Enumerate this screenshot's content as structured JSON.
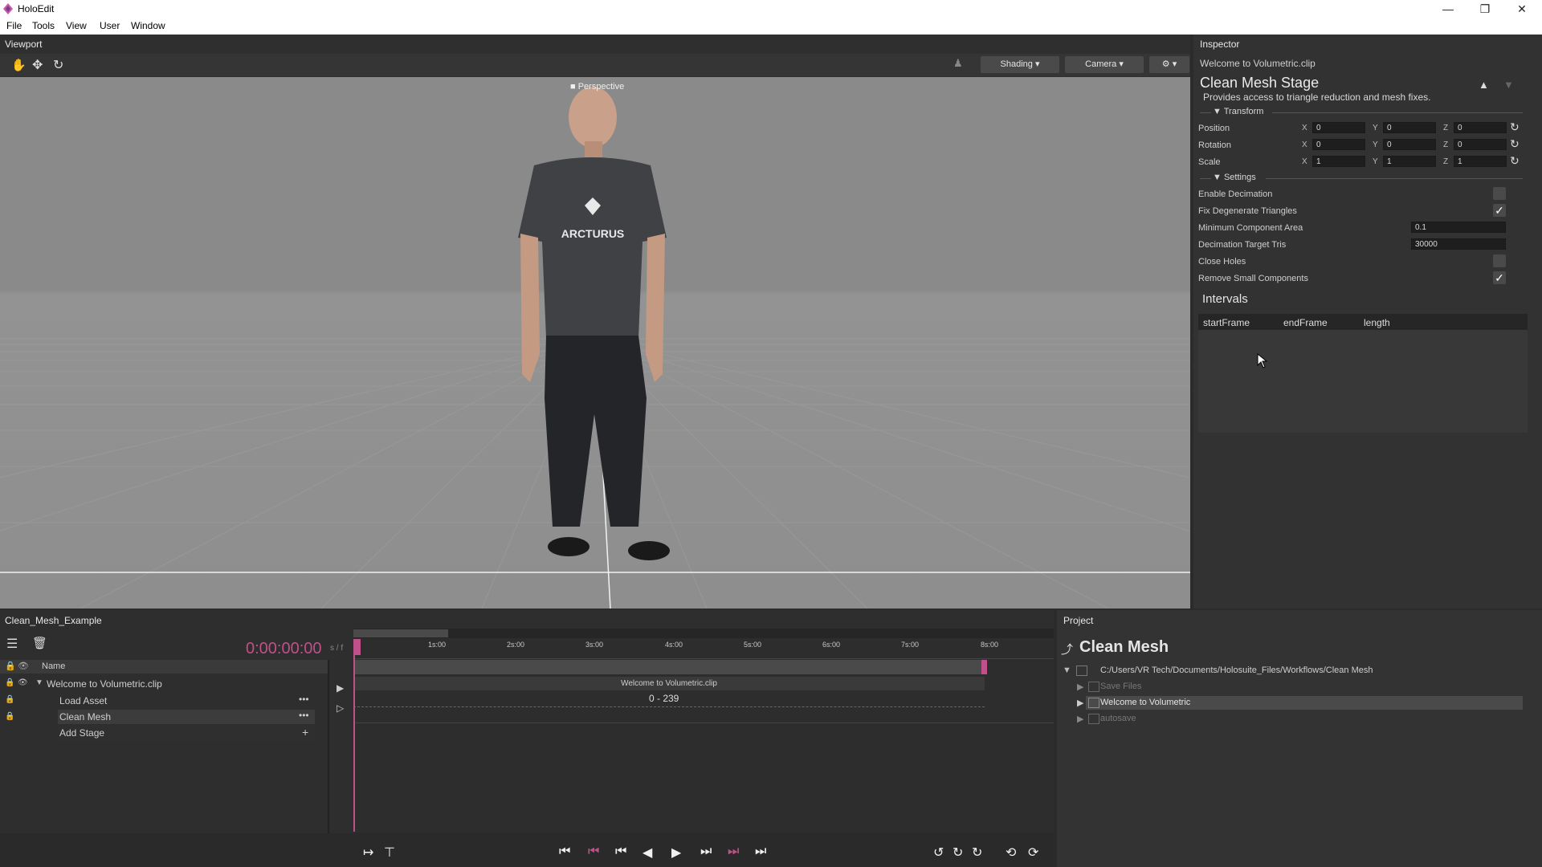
{
  "app": {
    "title": "HoloEdit",
    "window_controls": [
      "—",
      "❐",
      "✕"
    ]
  },
  "menu": [
    "File",
    "Tools",
    "View",
    "User",
    "Window"
  ],
  "viewport": {
    "tab": "Viewport",
    "shading_label": "Shading",
    "camera_label": "Camera",
    "perspective_label": "Perspective",
    "shirt_text": "ARCTURUS"
  },
  "inspector": {
    "tab": "Inspector",
    "clip_name": "Welcome to Volumetric.clip",
    "stage_title": "Clean Mesh Stage",
    "stage_desc": "Provides access to triangle reduction and mesh fixes.",
    "transform_label": "Transform",
    "position_label": "Position",
    "rotation_label": "Rotation",
    "scale_label": "Scale",
    "axis_x": "X",
    "axis_y": "Y",
    "axis_z": "Z",
    "position": [
      "0",
      "0",
      "0"
    ],
    "rotation": [
      "0",
      "0",
      "0"
    ],
    "scale": [
      "1",
      "1",
      "1"
    ],
    "settings_label": "Settings",
    "settings": [
      {
        "label": "Enable Decimation",
        "checked": false
      },
      {
        "label": "Fix Degenerate Triangles",
        "checked": true
      },
      {
        "label": "Minimum Component Area",
        "value": "0.1"
      },
      {
        "label": "Decimation Target Tris",
        "value": "30000"
      },
      {
        "label": "Close Holes",
        "checked": false
      },
      {
        "label": "Remove Small Components",
        "checked": true
      }
    ],
    "intervals_title": "Intervals",
    "intervals_cols": [
      "startFrame",
      "endFrame",
      "length"
    ]
  },
  "timeline": {
    "tab": "Clean_Mesh_Example",
    "timecode": "0:00:00:00",
    "timecode_unit": "s / f",
    "name_header": "Name",
    "clip_row": "Welcome to Volumetric.clip",
    "stages": [
      "Load Asset",
      "Clean Mesh",
      "Add Stage"
    ],
    "ticks": [
      "1s:00",
      "2s:00",
      "3s:00",
      "4s:00",
      "5s:00",
      "6s:00",
      "7s:00",
      "8s:00"
    ],
    "clip_bar_label": "Welcome to Volumetric.clip",
    "frame_range": "0 - 239",
    "accent": "#c0508a"
  },
  "project": {
    "tab": "Project",
    "title": "Clean Mesh",
    "path": "C:/Users/VR Tech/Documents/Holosuite_Files/Workflows/Clean Mesh",
    "items": [
      "Save Files",
      "Welcome to Volumetric",
      "autosave"
    ]
  }
}
